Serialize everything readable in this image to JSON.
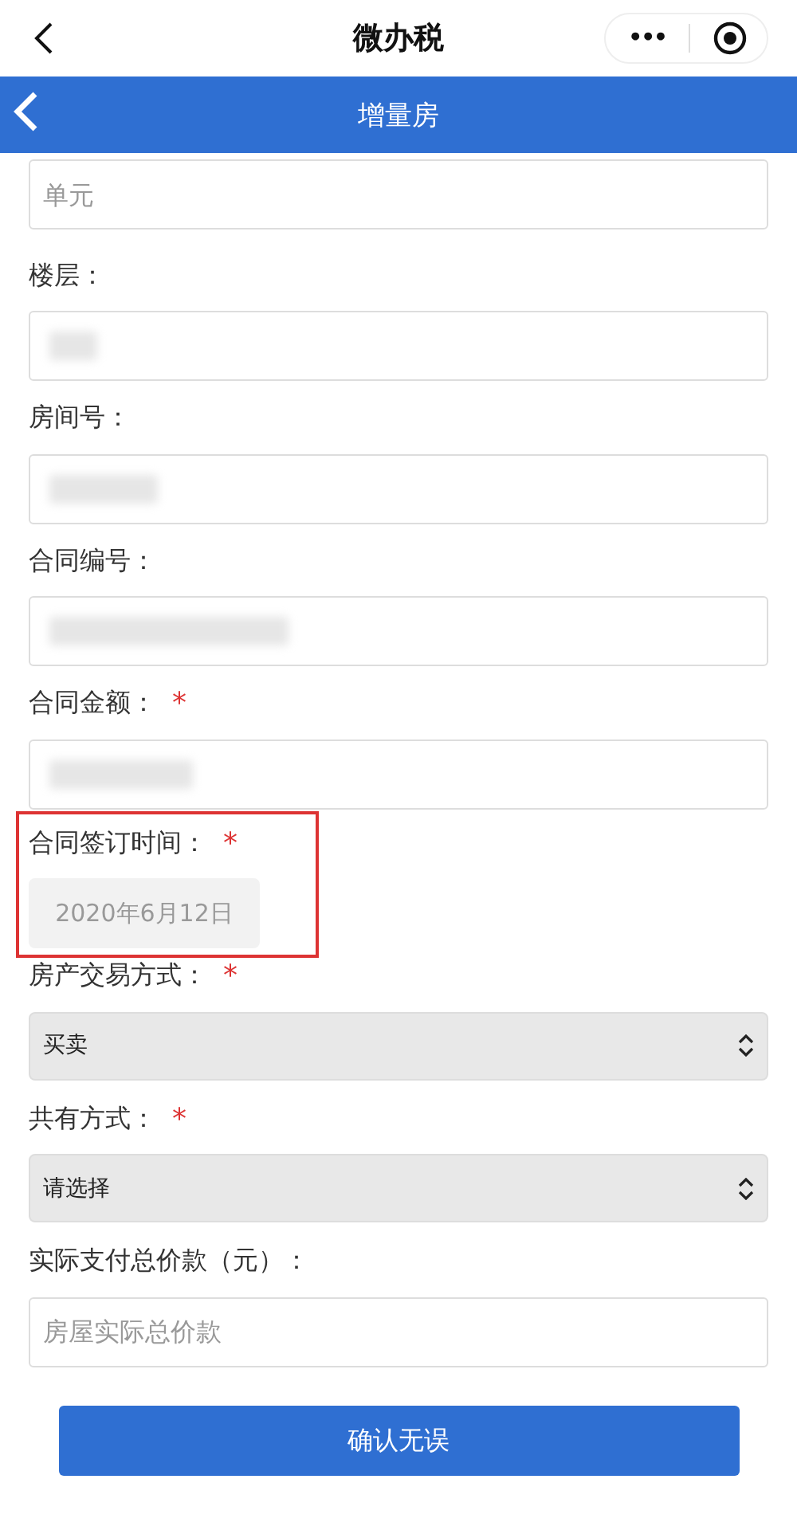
{
  "mini_bar": {
    "title": "微办税",
    "more": "•••"
  },
  "header": {
    "title": "增量房"
  },
  "required_mark": "*",
  "fields": [
    {
      "kind": "text",
      "placeholder": "单元"
    },
    {
      "kind": "blurred",
      "label": "楼层：",
      "required": false
    },
    {
      "kind": "blurred",
      "label": "房间号：",
      "required": false
    },
    {
      "kind": "blurred",
      "label": "合同编号：",
      "required": false
    },
    {
      "kind": "blurred",
      "label": "合同金额：",
      "required": true
    },
    {
      "kind": "date",
      "label": "合同签订时间：",
      "required": true,
      "value": "2020年6月12日",
      "disabled": true,
      "highlighted": true
    },
    {
      "kind": "select",
      "label": "房产交易方式：",
      "required": true,
      "value": "买卖"
    },
    {
      "kind": "select",
      "label": "共有方式：",
      "required": true,
      "value": "请选择"
    },
    {
      "kind": "text",
      "label": "实际支付总价款（元）：",
      "required": false,
      "placeholder": "房屋实际总价款"
    }
  ],
  "submit": "确认无误"
}
